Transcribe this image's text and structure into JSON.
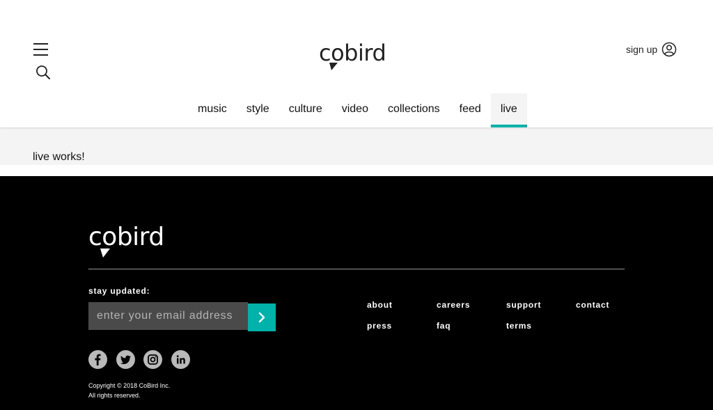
{
  "header": {
    "logo_text": "cobird",
    "signup_label": "sign up"
  },
  "nav": {
    "items": [
      {
        "label": "music"
      },
      {
        "label": "style"
      },
      {
        "label": "culture"
      },
      {
        "label": "video"
      },
      {
        "label": "collections"
      },
      {
        "label": "feed"
      },
      {
        "label": "live",
        "active": true
      }
    ]
  },
  "content": {
    "text": "live works!"
  },
  "footer": {
    "logo_text": "cobird",
    "stay_label": "stay updated:",
    "email_placeholder": "enter your email address",
    "links": [
      {
        "label": "about"
      },
      {
        "label": "careers"
      },
      {
        "label": "support"
      },
      {
        "label": "contact"
      },
      {
        "label": "press"
      },
      {
        "label": "faq"
      },
      {
        "label": "terms"
      }
    ],
    "social": [
      {
        "icon": "facebook-icon"
      },
      {
        "icon": "twitter-icon"
      },
      {
        "icon": "instagram-icon"
      },
      {
        "icon": "linkedin-icon"
      }
    ],
    "copyright_line1": "Copyright © 2018 CoBird Inc.",
    "copyright_line2": "All rights reserved."
  },
  "colors": {
    "accent": "#00b2a9",
    "footer_bg": "#000000",
    "content_bg": "#f4f4f4"
  }
}
